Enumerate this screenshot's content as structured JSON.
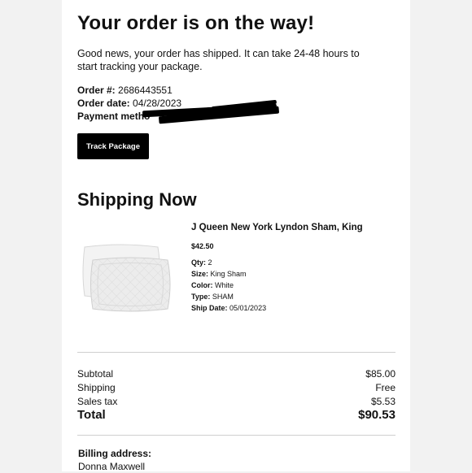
{
  "header": {
    "title": "Your order is on the way!",
    "intro": "Good news, your order has shipped. It can take 24-48 hours to start tracking your package."
  },
  "order": {
    "number_label": "Order #:",
    "number_value": "2686443551",
    "date_label": "Order date:",
    "date_value": "04/28/2023",
    "payment_label": "Payment metho"
  },
  "actions": {
    "track_label": "Track Package"
  },
  "shipping": {
    "title": "Shipping Now",
    "product": {
      "name": "J Queen New York Lyndon Sham, King",
      "price": "$42.50",
      "image_icon": "pillow-sham-image",
      "attributes": [
        {
          "label": "Qty:",
          "value": "2"
        },
        {
          "label": "Size:",
          "value": "King Sham"
        },
        {
          "label": "Color:",
          "value": "White"
        },
        {
          "label": "Type:",
          "value": "SHAM"
        },
        {
          "label": "Ship Date:",
          "value": "05/01/2023"
        }
      ]
    }
  },
  "summary": {
    "subtotal_label": "Subtotal",
    "subtotal_value": "$85.00",
    "shipping_label": "Shipping",
    "shipping_value": "Free",
    "tax_label": "Sales tax",
    "tax_value": "$5.53",
    "total_label": "Total",
    "total_value": "$90.53"
  },
  "billing": {
    "label": "Billing address:",
    "name": "Donna Maxwell"
  },
  "colors": {
    "button_bg": "#000000",
    "page_bg": "#ffffff",
    "outer_bg": "#f2f2f2"
  }
}
